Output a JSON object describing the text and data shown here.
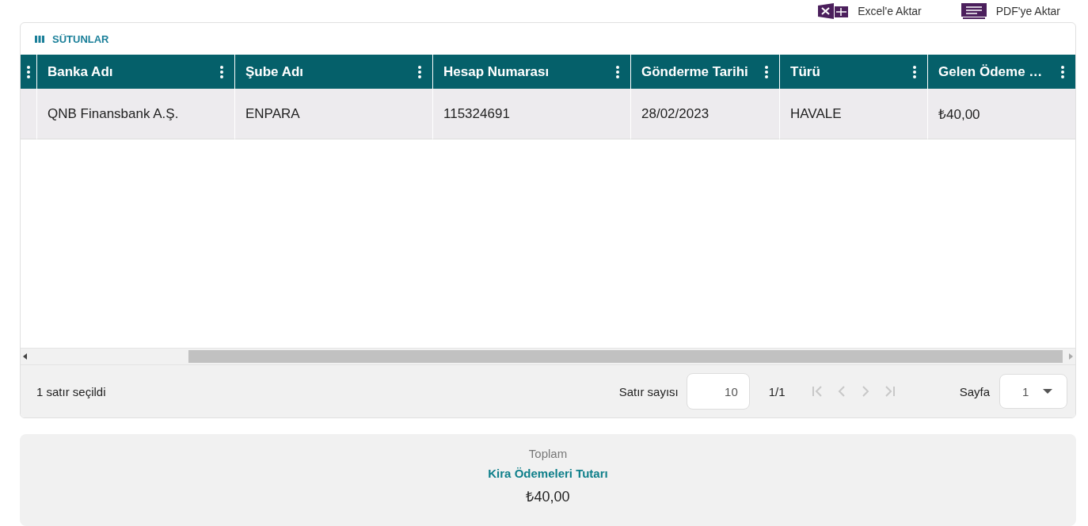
{
  "export_buttons": [
    {
      "kind": "excel",
      "label": "Excel'e Aktar"
    },
    {
      "kind": "pdf",
      "label": "PDF'ye Aktar"
    }
  ],
  "columns_button": {
    "label": "SÜTUNLAR"
  },
  "table": {
    "columns": [
      {
        "label": "Banka Adı"
      },
      {
        "label": "Şube Adı"
      },
      {
        "label": "Hesap Numarası"
      },
      {
        "label": "Gönderme Tarihi"
      },
      {
        "label": "Türü"
      },
      {
        "label": "Gelen Ödeme …"
      }
    ],
    "rows": [
      {
        "selected": true,
        "cells": [
          "QNB Finansbank A.Ş.",
          "ENPARA",
          "115324691",
          "28/02/2023",
          "HAVALE",
          "₺40,00"
        ]
      }
    ]
  },
  "footer": {
    "selection_text": "1 satır seçildi",
    "rows_per_page_label": "Satır sayısı",
    "rows_per_page": "10",
    "page_info": "1/1",
    "page_label": "Sayfa",
    "page": "1"
  },
  "summary": {
    "caption": "Toplam",
    "title": "Kira Ödemeleri Tutarı",
    "value": "₺40,00"
  }
}
